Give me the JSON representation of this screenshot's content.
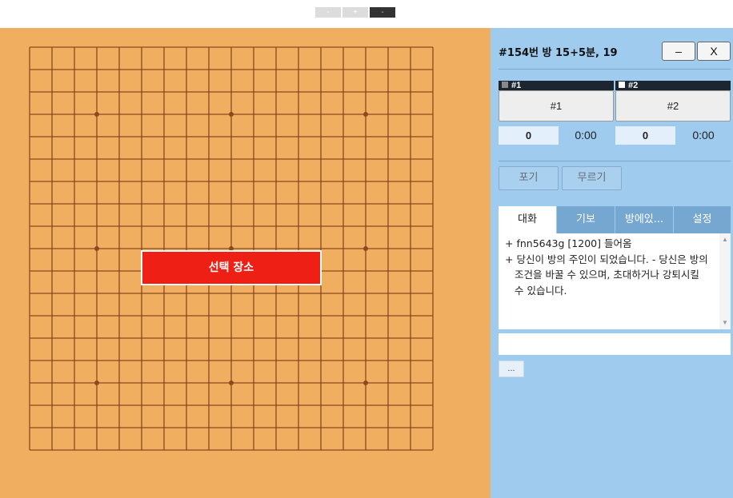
{
  "zoom": {
    "out_label": "-",
    "in_label": "+",
    "reset_label": "-"
  },
  "board": {
    "size": 19,
    "line_color": "#8b4a1e",
    "background": "#f0ae60",
    "star_points": [
      [
        3,
        3
      ],
      [
        9,
        3
      ],
      [
        15,
        3
      ],
      [
        3,
        9
      ],
      [
        9,
        9
      ],
      [
        15,
        9
      ],
      [
        3,
        15
      ],
      [
        9,
        15
      ],
      [
        15,
        15
      ]
    ],
    "choose_place_label": "선택 장소"
  },
  "panel": {
    "room_title": "#154번 방   15+5분, 19",
    "minimize_label": "–",
    "close_label": "X",
    "players": [
      {
        "head": "#1",
        "name": "#1",
        "score": "0",
        "time": "0:00",
        "stone_color": "#888888"
      },
      {
        "head": "#2",
        "name": "#2",
        "score": "0",
        "time": "0:00",
        "stone_color": "#ffffff"
      }
    ],
    "resign_label": "포기",
    "undo_label": "무르기",
    "tabs": [
      {
        "label": "대화",
        "active": true
      },
      {
        "label": "기보",
        "active": false
      },
      {
        "label": "방에있...",
        "active": false
      },
      {
        "label": "설정",
        "active": false
      }
    ],
    "chat": [
      "+ fnn5643g [1200] 들어옴",
      "+ 당신이 방의 주인이 되었습니다. - 당신은 방의 조건을 바꿀 수 있으며, 초대하거나 강퇴시킬 수 있습니다."
    ],
    "chat_input_placeholder": "",
    "more_label": "..."
  }
}
